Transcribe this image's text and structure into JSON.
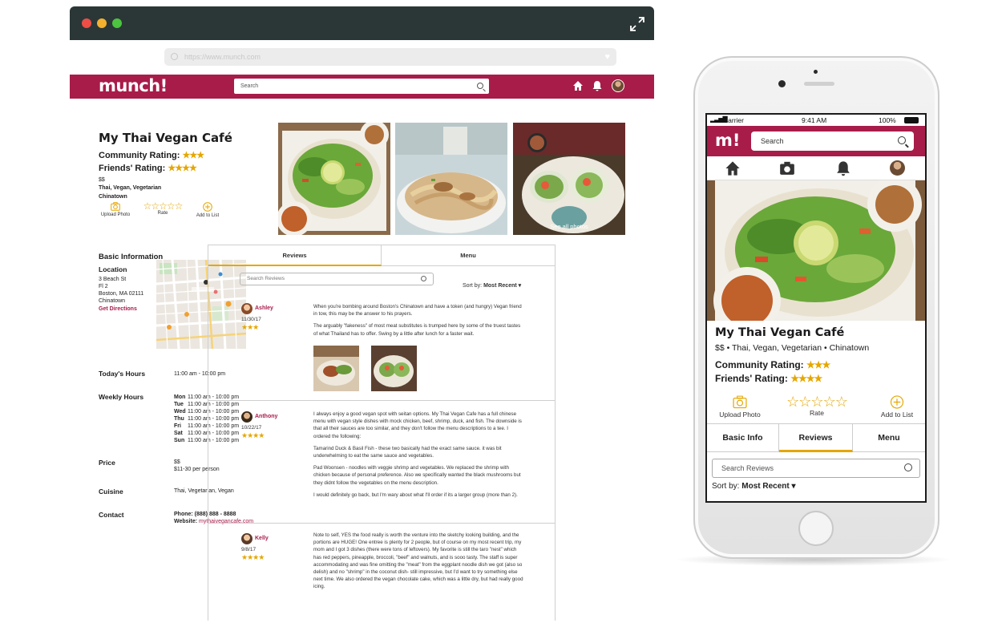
{
  "browser": {
    "url": "https://www.munch.com",
    "search_placeholder": "Search",
    "logo": "munch!"
  },
  "restaurant": {
    "name": "My Thai Vegan Café",
    "community_rating_label": "Community Rating:",
    "community_stars": "★★★",
    "friends_rating_label": "Friends' Rating:",
    "friends_stars": "★★★★",
    "price": "$$",
    "categories": "Thai, Vegan, Vegetarian",
    "neighborhood": "Chinatown",
    "actions": {
      "upload": "Upload Photo",
      "rate": "Rate",
      "add": "Add to List"
    }
  },
  "basic_info": {
    "heading": "Basic Information",
    "location_label": "Location",
    "address": [
      "3 Beach St",
      "Fl 2",
      "Boston, MA 02111",
      "Chinatown"
    ],
    "directions": "Get Directions",
    "todays_hours_label": "Today's Hours",
    "todays_hours": "11:00 am - 10:00 pm",
    "weekly_hours_label": "Weekly Hours",
    "weekly_hours": [
      {
        "day": "Mon",
        "hours": "11:00 am - 10:00 pm"
      },
      {
        "day": "Tue",
        "hours": "11:00 am - 10:00 pm"
      },
      {
        "day": "Wed",
        "hours": "11:00 am - 10:00 pm"
      },
      {
        "day": "Thu",
        "hours": "11:00 am - 10:00 pm"
      },
      {
        "day": "Fri",
        "hours": "11:00 am - 10:00 pm"
      },
      {
        "day": "Sat",
        "hours": "11:00 am - 10:00 pm"
      },
      {
        "day": "Sun",
        "hours": "11:00 am - 10:00 pm"
      }
    ],
    "price_label": "Price",
    "price": "$$",
    "price_detail": "$11-30 per person",
    "cuisine_label": "Cuisine",
    "cuisine": "Thai, Vegetarian, Vegan",
    "contact_label": "Contact",
    "phone": "Phone: (888) 888 - 8888",
    "website_label": "Website: ",
    "website": "mythaivegancafe.com"
  },
  "photos": {
    "see_all": "See all photos"
  },
  "reviews_panel": {
    "tab_reviews": "Reviews",
    "tab_menu": "Menu",
    "search_placeholder": "Search Reviews",
    "sort_label": "Sort by: ",
    "sort_value": "Most Recent ▾"
  },
  "reviews": [
    {
      "name": "Ashley",
      "date": "11/30/17",
      "stars": "★★★",
      "paragraphs": [
        "When you're bombing around Boston's Chinatown and have a token (and hungry) Vegan friend in tow, this may be the answer to his prayers.",
        "The arguably \"fakeness\" of most meat substitutes is trumped here by some of the truest tastes of what Thailand has to offer. Swing by a little after lunch for a faster wait."
      ]
    },
    {
      "name": "Anthony",
      "date": "10/22/17",
      "stars": "★★★★",
      "paragraphs": [
        "I always enjoy a good vegan spot with seitan options. My Thai Vegan Cafe has a full chinese menu with vegan style dishes with mock chicken, beef, shrimp, duck, and fish. The downside is that all their sauces are too similar, and they don't follow the menu descriptions to a tee. I ordered the following:",
        "Tamarind Duck & Basil Fish - these two basically had the exact same sauce. it was bit underwhelming to eat the same sauce and vegetables.",
        "Pad Woonsen - noodles with veggie shrimp and vegetables. We replaced the shrimp with chicken because of personal preference. Also we specifically wanted the black mushrooms but they didnt follow the vegetables on the menu description.",
        "I would definitely go back, but I'm wary about what I'll order if its a larger group (more than 2)."
      ]
    },
    {
      "name": "Kelly",
      "date": "9/8/17",
      "stars": "★★★★",
      "paragraphs": [
        "Note to self, YES the food really is worth the venture into the sketchy looking building, and the portions are HUGE! One entree is plenty for 2 people, but of course on my most recent trip, my mom and I got 3 dishes (there were tons of leftovers). My favorite is still the taro \"nest\" which has red peppers, pineapple, broccoli, \"beef\" and walnuts, and is sooo tasty. The staff is super accommodating and was fine omitting the \"meat\" from the eggplant noodle dish we got (also so delish) and no \"shrimp\" in the coconut dish- still impressive, but I'd want to try something else next time. We also ordered the vegan chocolate cake, which was a little dry, but had really good icing."
      ]
    }
  ],
  "phone": {
    "carrier": "Carrier",
    "time": "9:41 AM",
    "battery": "100%",
    "logo": "m!",
    "search_placeholder": "Search",
    "name": "My Thai Vegan Café",
    "meta": "$$  •  Thai, Vegan, Vegetarian  •  Chinatown",
    "community_label": "Community Rating:",
    "community_stars": "★★★",
    "friends_label": "Friends' Rating:",
    "friends_stars": "★★★★",
    "upload": "Upload Photo",
    "rate": "Rate",
    "add": "Add to List",
    "tab_basic": "Basic Info",
    "tab_reviews": "Reviews",
    "tab_menu": "Menu",
    "review_search": "Search Reviews",
    "sort_label": "Sort by: ",
    "sort_value": "Most Recent ▾"
  },
  "colors": {
    "brand": "#a81c4a",
    "star": "#e5a600",
    "titlebar": "#2b3737"
  }
}
